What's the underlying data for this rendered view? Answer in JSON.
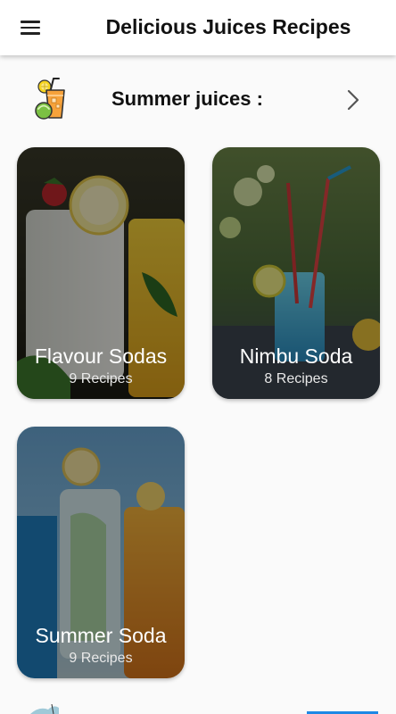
{
  "app": {
    "title": "Delicious Juices Recipes",
    "menu_icon": "hamburger-menu-icon"
  },
  "section": {
    "title": "Summer juices :",
    "icon": "juice-glass-icon",
    "arrow_icon": "chevron-right-icon"
  },
  "cards": [
    {
      "title": "Flavour Sodas",
      "count": "9 Recipes"
    },
    {
      "title": "Nimbu Soda",
      "count": "8 Recipes"
    },
    {
      "title": "Summer Soda",
      "count": "9 Recipes"
    }
  ],
  "colors": {
    "appbar_bg": "#ffffff",
    "page_bg": "#fafafa",
    "text_dark": "#111111",
    "card_text": "#ffffff",
    "accent_blue": "#1e88e5"
  }
}
